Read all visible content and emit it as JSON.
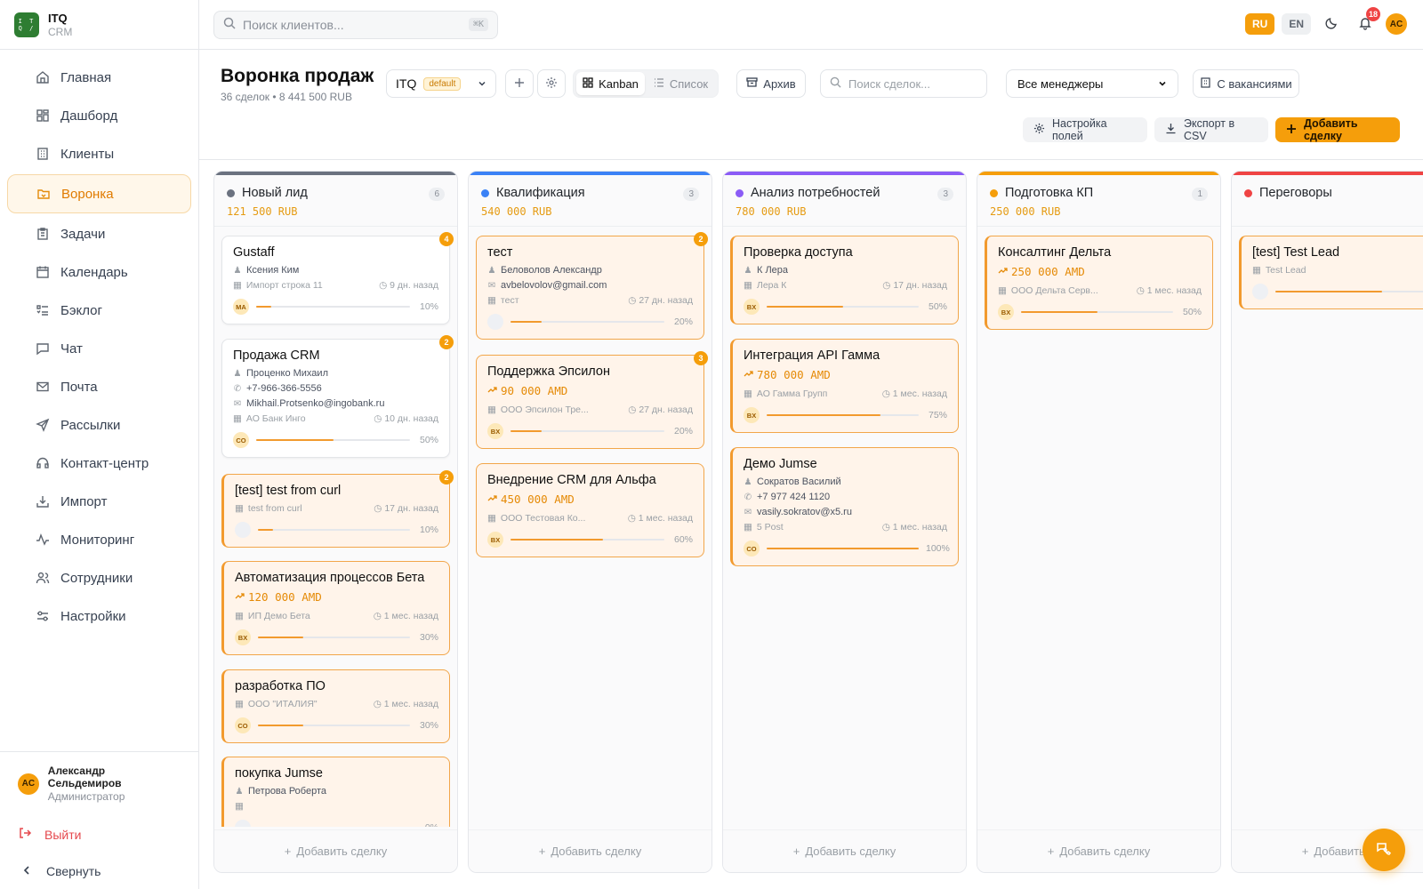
{
  "brand": {
    "name": "ITQ",
    "sub": "CRM",
    "logo_text": "ITQ"
  },
  "nav": [
    {
      "label": "Главная",
      "icon": "home-icon"
    },
    {
      "label": "Дашборд",
      "icon": "dashboard-icon"
    },
    {
      "label": "Клиенты",
      "icon": "building-icon"
    },
    {
      "label": "Воронка",
      "icon": "folder-icon",
      "active": true
    },
    {
      "label": "Задачи",
      "icon": "clipboard-icon"
    },
    {
      "label": "Календарь",
      "icon": "calendar-icon"
    },
    {
      "label": "Бэклог",
      "icon": "list-icon"
    },
    {
      "label": "Чат",
      "icon": "chat-icon"
    },
    {
      "label": "Почта",
      "icon": "mail-icon"
    },
    {
      "label": "Рассылки",
      "icon": "send-icon"
    },
    {
      "label": "Контакт-центр",
      "icon": "headset-icon"
    },
    {
      "label": "Импорт",
      "icon": "import-icon"
    },
    {
      "label": "Мониторинг",
      "icon": "activity-icon"
    },
    {
      "label": "Сотрудники",
      "icon": "users-icon"
    },
    {
      "label": "Настройки",
      "icon": "sliders-icon"
    }
  ],
  "user": {
    "initials": "AC",
    "name": "Александр Сельдемиров",
    "role": "Администратор"
  },
  "logout_label": "Выйти",
  "collapse_label": "Свернуть",
  "topbar": {
    "search_placeholder": "Поиск клиентов...",
    "shortcut": "⌘K",
    "lang_ru": "RU",
    "lang_en": "EN",
    "notifications": "18",
    "avatar": "AC"
  },
  "header": {
    "title": "Воронка продаж",
    "subtitle": "36 сделок • 8 441 500 RUB",
    "pipeline": "ITQ",
    "pipeline_tag": "default",
    "view_kanban": "Kanban",
    "view_list": "Список",
    "archive": "Архив",
    "deal_search_placeholder": "Поиск сделок...",
    "manager_filter": "Все менеджеры",
    "vacancies": "С вакансиями",
    "fields_settings": "Настройка полей",
    "export_csv": "Экспорт в CSV",
    "add_deal": "Добавить сделку"
  },
  "add_deal_footer": "Добавить сделку",
  "colors": {
    "accent": "#f59e0b",
    "stage_new": "#6b7280",
    "stage_qual": "#3b82f6",
    "stage_needs": "#8b5cf6",
    "stage_kp": "#f59e0b",
    "stage_nego": "#ef4444"
  },
  "columns": [
    {
      "title": "Новый лид",
      "count": "6",
      "sum": "121 500 RUB",
      "color": "#6b7280",
      "dot": "#6b7280",
      "cards": [
        {
          "title": "Gustaff",
          "badge": "4",
          "white": true,
          "contact": "Ксения Ким",
          "company": "Импорт строка 11",
          "time": "9 дн. назад",
          "av": "MA",
          "pct": 10
        },
        {
          "title": "Продажа CRM",
          "badge": "2",
          "white": true,
          "contact": "Проценко Михаил",
          "phone": "+7-966-366-5556",
          "email": "Mikhail.Protsenko@ingobank.ru",
          "company": "АО Банк Инго",
          "time": "10 дн. назад",
          "av": "CO",
          "pct": 50
        },
        {
          "title": "[test] test from curl",
          "badge": "2",
          "hot": true,
          "company": "test from curl",
          "time": "17 дн. назад",
          "av": "",
          "pct": 10
        },
        {
          "title": "Автоматизация процессов Бета",
          "hot": true,
          "amount": "120 000 AMD",
          "company": "ИП Демо Бета",
          "time": "1 мес. назад",
          "av": "BX",
          "pct": 30
        },
        {
          "title": "разработка ПО",
          "hot": true,
          "company": "ООО \"ИТАЛИЯ\"",
          "time": "1 мес. назад",
          "av": "CO",
          "pct": 30
        },
        {
          "title": "покупка Jumse",
          "hot": true,
          "contact": "Петрова Роберта",
          "company": "",
          "time": "",
          "av": "",
          "pct": 0
        }
      ]
    },
    {
      "title": "Квалификация",
      "count": "3",
      "sum": "540 000 RUB",
      "color": "#3b82f6",
      "dot": "#3b82f6",
      "cards": [
        {
          "title": "тест",
          "badge": "2",
          "contact": "Беловолов Александр",
          "email": "avbelovolov@gmail.com",
          "company": "тест",
          "time": "27 дн. назад",
          "av": "",
          "pct": 20
        },
        {
          "title": "Поддержка Эпсилон",
          "badge": "3",
          "amount": "90 000 AMD",
          "company": "ООО Эпсилон Тре...",
          "time": "27 дн. назад",
          "av": "BX",
          "pct": 20
        },
        {
          "title": "Внедрение CRM для Альфа",
          "amount": "450 000 AMD",
          "company": "ООО Тестовая Ко...",
          "time": "1 мес. назад",
          "av": "BX",
          "pct": 60
        }
      ]
    },
    {
      "title": "Анализ потребностей",
      "count": "3",
      "sum": "780 000 RUB",
      "color": "#8b5cf6",
      "dot": "#8b5cf6",
      "cards": [
        {
          "title": "Проверка доступа",
          "hot": true,
          "contact": "К Лера",
          "company": "Лера К",
          "time": "17 дн. назад",
          "av": "BX",
          "pct": 50
        },
        {
          "title": "Интеграция API Гамма",
          "hot": true,
          "amount": "780 000 AMD",
          "company": "АО Гамма Групп",
          "time": "1 мес. назад",
          "av": "BX",
          "pct": 75
        },
        {
          "title": "Демо Jumse",
          "hot": true,
          "contact": "Сократов Василий",
          "phone": "+7 977 424 1120",
          "email": "vasily.sokratov@x5.ru",
          "company": "5 Post",
          "time": "1 мес. назад",
          "av": "CO",
          "pct": 100
        }
      ]
    },
    {
      "title": "Подготовка КП",
      "count": "1",
      "sum": "250 000 RUB",
      "color": "#f59e0b",
      "dot": "#f59e0b",
      "cards": [
        {
          "title": "Консалтинг Дельта",
          "hot": true,
          "amount": "250 000 AMD",
          "company": "ООО Дельта Серв...",
          "time": "1 мес. назад",
          "av": "BX",
          "pct": 50
        }
      ]
    },
    {
      "title": "Переговоры",
      "count": "",
      "sum": "",
      "color": "#ef4444",
      "dot": "#ef4444",
      "cards": [
        {
          "title": "[test] Test Lead",
          "hot": true,
          "company": "Test Lead",
          "time": "",
          "av": "",
          "pct": 70
        }
      ]
    }
  ]
}
